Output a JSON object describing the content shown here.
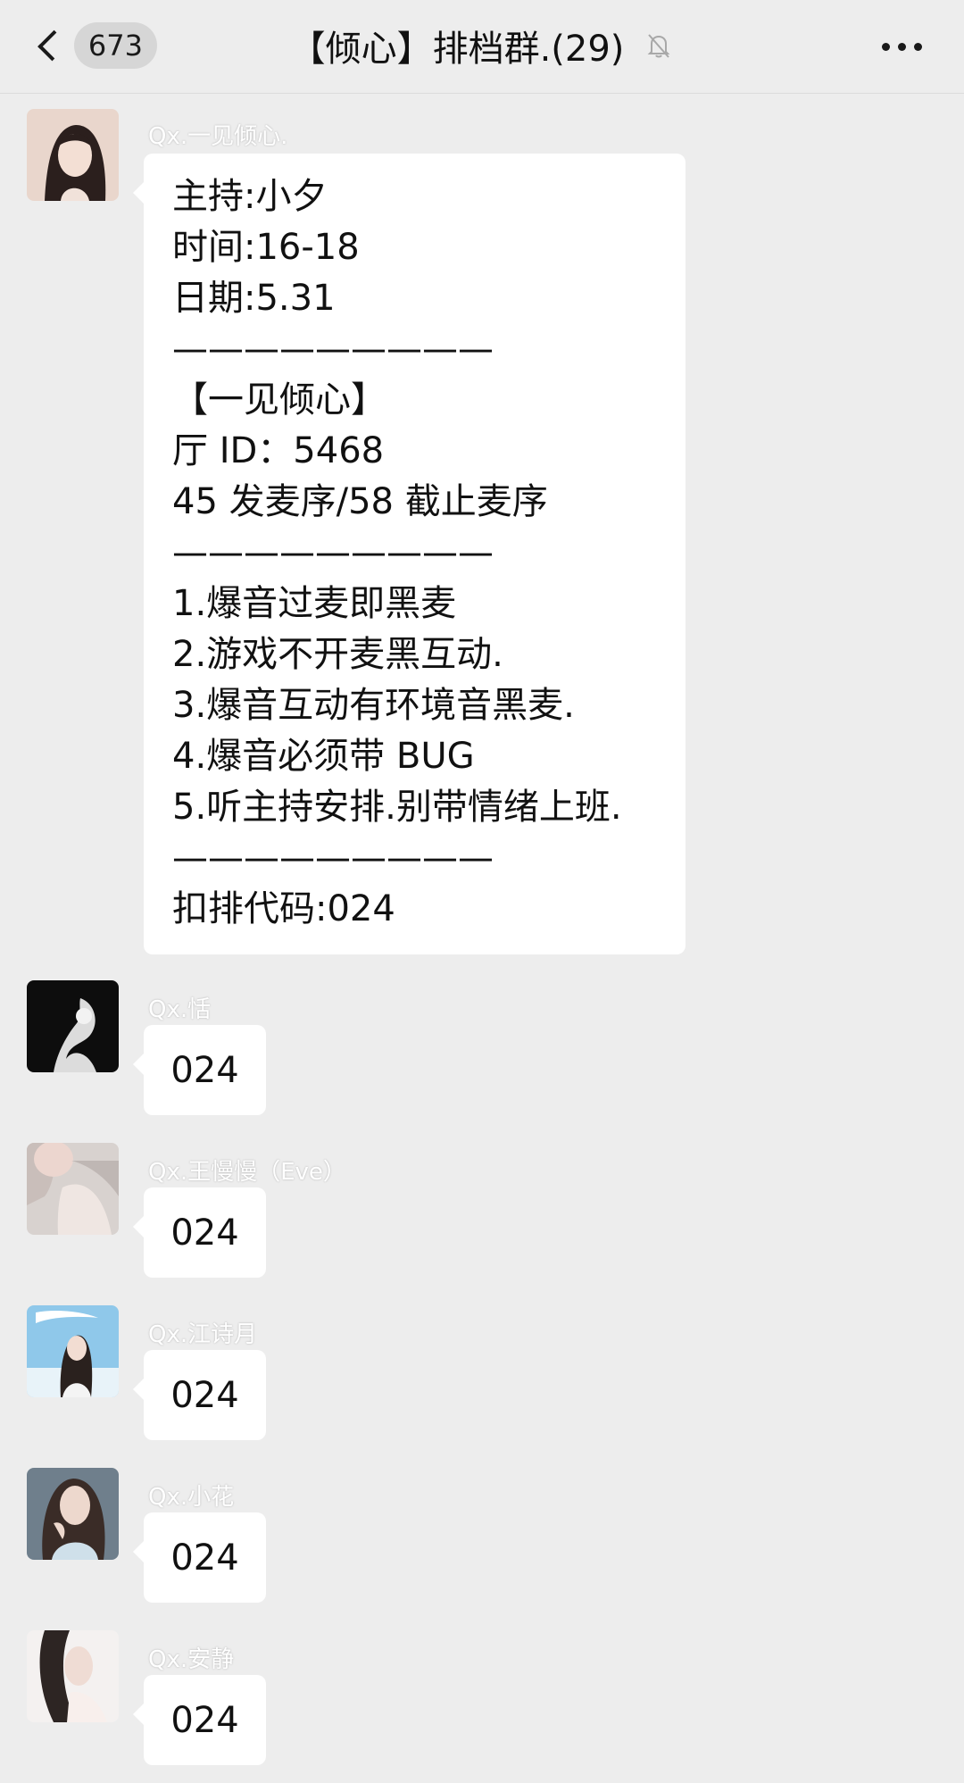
{
  "header": {
    "unread_count": "673",
    "title": "【倾心】排档群.(29)"
  },
  "messages": [
    {
      "sender": "Qx.一见倾心.",
      "lines": [
        "主持:小夕",
        "时间:16-18",
        "日期:5.31",
        "—————————",
        "【一见倾心】",
        "厅 ID：5468",
        "45 发麦序/58 截止麦序",
        "—————————",
        "1.爆音过麦即黑麦",
        "2.游戏不开麦黑互动.",
        "3.爆音互动有环境音黑麦.",
        "4.爆音必须带 BUG",
        "5.听主持安排.别带情绪上班.",
        "—————————",
        "扣排代码:024"
      ]
    },
    {
      "sender": "Qx.恬",
      "text": "024"
    },
    {
      "sender": "Qx.王慢慢（Eve）",
      "text": "024"
    },
    {
      "sender": "Qx.江诗月",
      "text": "024"
    },
    {
      "sender": "Qx.小花",
      "text": "024"
    },
    {
      "sender": "Qx.安静",
      "text": "024"
    }
  ]
}
